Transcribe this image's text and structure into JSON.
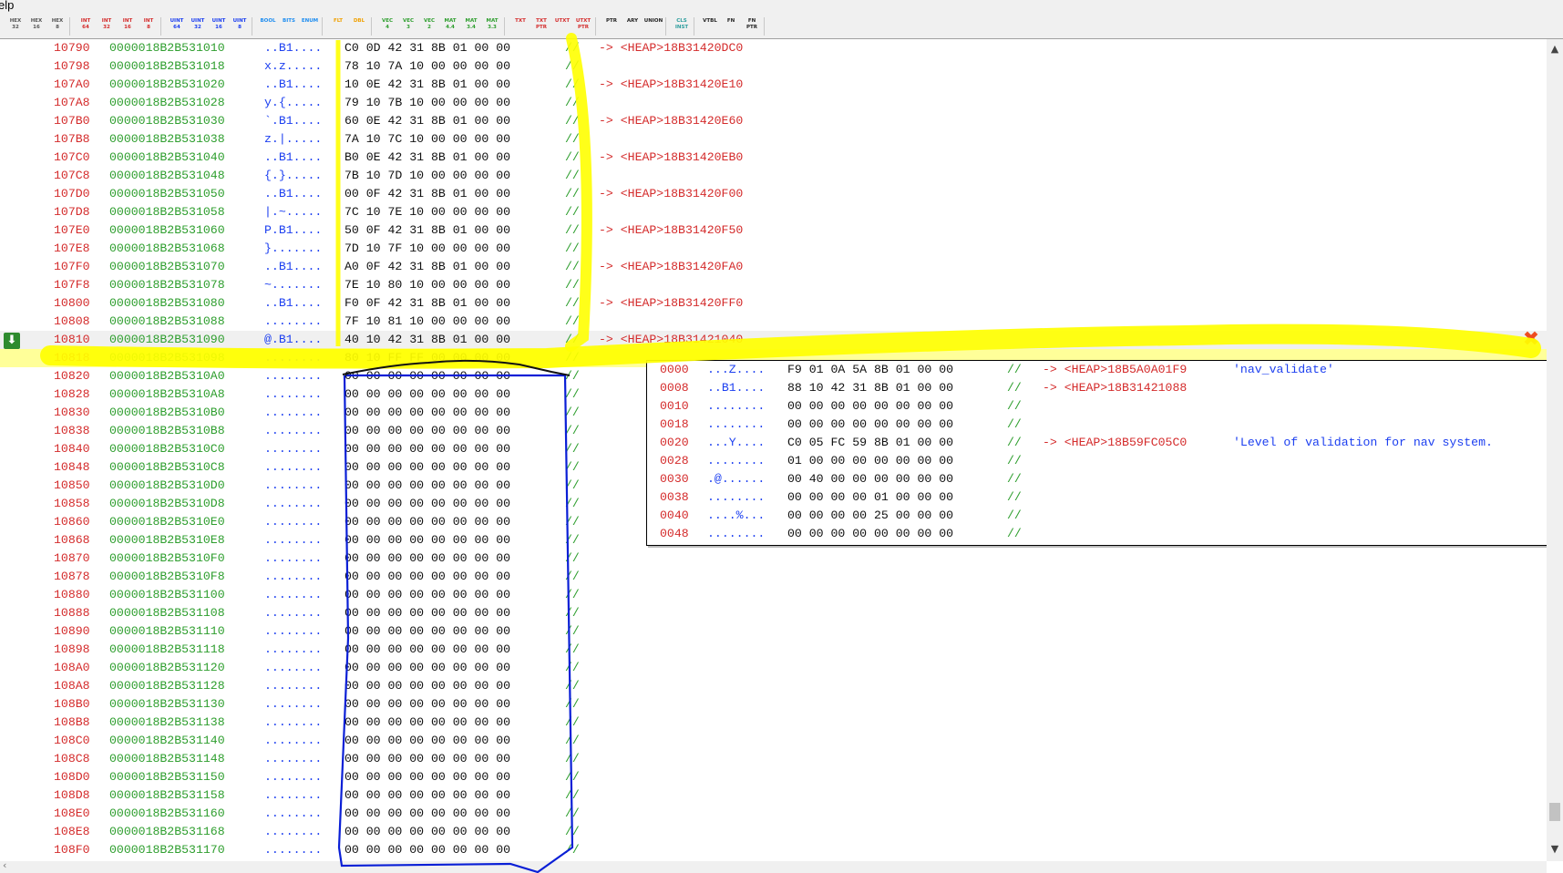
{
  "menu": {
    "help_label": "elp"
  },
  "toolbar": {
    "groups": [
      {
        "color": "#555555",
        "buttons": [
          {
            "top": "HEX",
            "bottom": "32"
          },
          {
            "top": "HEX",
            "bottom": "16"
          },
          {
            "top": "HEX",
            "bottom": "8"
          }
        ]
      },
      {
        "color": "#d42b2b",
        "buttons": [
          {
            "top": "INT",
            "bottom": "64"
          },
          {
            "top": "INT",
            "bottom": "32"
          },
          {
            "top": "INT",
            "bottom": "16"
          },
          {
            "top": "INT",
            "bottom": "8"
          }
        ]
      },
      {
        "color": "#1c3ff0",
        "buttons": [
          {
            "top": "UINT",
            "bottom": "64"
          },
          {
            "top": "UINT",
            "bottom": "32"
          },
          {
            "top": "UINT",
            "bottom": "16"
          },
          {
            "top": "UINT",
            "bottom": "8"
          }
        ]
      },
      {
        "color": "#1c8cf0",
        "buttons": [
          {
            "top": "BOOL",
            "bottom": ""
          },
          {
            "top": "BITS",
            "bottom": ""
          },
          {
            "top": "ENUM",
            "bottom": ""
          }
        ]
      },
      {
        "color": "#f0a000",
        "buttons": [
          {
            "top": "FLT",
            "bottom": ""
          },
          {
            "top": "DBL",
            "bottom": ""
          }
        ]
      },
      {
        "color": "#2e9e2e",
        "buttons": [
          {
            "top": "VEC",
            "bottom": "4"
          },
          {
            "top": "VEC",
            "bottom": "3"
          },
          {
            "top": "VEC",
            "bottom": "2"
          },
          {
            "top": "MAT",
            "bottom": "4.4"
          },
          {
            "top": "MAT",
            "bottom": "3.4"
          },
          {
            "top": "MAT",
            "bottom": "3.3"
          }
        ]
      },
      {
        "color": "#d42b2b",
        "buttons": [
          {
            "top": "TXT",
            "bottom": ""
          },
          {
            "top": "TXT",
            "bottom": "PTR"
          },
          {
            "top": "UTXT",
            "bottom": ""
          },
          {
            "top": "UTXT",
            "bottom": "PTR"
          }
        ]
      },
      {
        "color": "#222222",
        "buttons": [
          {
            "top": "PTR",
            "bottom": ""
          },
          {
            "top": "ARY",
            "bottom": ""
          },
          {
            "top": "UNION",
            "bottom": ""
          }
        ]
      },
      {
        "color": "#2e9e9e",
        "buttons": [
          {
            "top": "CLS",
            "bottom": "INST"
          }
        ]
      },
      {
        "color": "#222222",
        "buttons": [
          {
            "top": "VTBL",
            "bottom": ""
          },
          {
            "top": "FN",
            "bottom": ""
          },
          {
            "top": "FN",
            "bottom": "PTR"
          }
        ]
      }
    ]
  },
  "rows": [
    {
      "off": "10790",
      "addr": "0000018B2B531010",
      "ascii": "..B1....",
      "hex": "C0 0D 42 31 8B 01 00 00",
      "cmt": "//",
      "ptr": "-> <HEAP>18B31420DC0"
    },
    {
      "off": "10798",
      "addr": "0000018B2B531018",
      "ascii": "x.z.....",
      "hex": "78 10 7A 10 00 00 00 00",
      "cmt": "//",
      "ptr": ""
    },
    {
      "off": "107A0",
      "addr": "0000018B2B531020",
      "ascii": "..B1....",
      "hex": "10 0E 42 31 8B 01 00 00",
      "cmt": "//",
      "ptr": "-> <HEAP>18B31420E10"
    },
    {
      "off": "107A8",
      "addr": "0000018B2B531028",
      "ascii": "y.{.....",
      "hex": "79 10 7B 10 00 00 00 00",
      "cmt": "//",
      "ptr": ""
    },
    {
      "off": "107B0",
      "addr": "0000018B2B531030",
      "ascii": "`.B1....",
      "hex": "60 0E 42 31 8B 01 00 00",
      "cmt": "//",
      "ptr": "-> <HEAP>18B31420E60"
    },
    {
      "off": "107B8",
      "addr": "0000018B2B531038",
      "ascii": "z.|.....",
      "hex": "7A 10 7C 10 00 00 00 00",
      "cmt": "//",
      "ptr": ""
    },
    {
      "off": "107C0",
      "addr": "0000018B2B531040",
      "ascii": "..B1....",
      "hex": "B0 0E 42 31 8B 01 00 00",
      "cmt": "//",
      "ptr": "-> <HEAP>18B31420EB0"
    },
    {
      "off": "107C8",
      "addr": "0000018B2B531048",
      "ascii": "{.}.....",
      "hex": "7B 10 7D 10 00 00 00 00",
      "cmt": "//",
      "ptr": ""
    },
    {
      "off": "107D0",
      "addr": "0000018B2B531050",
      "ascii": "..B1....",
      "hex": "00 0F 42 31 8B 01 00 00",
      "cmt": "//",
      "ptr": "-> <HEAP>18B31420F00"
    },
    {
      "off": "107D8",
      "addr": "0000018B2B531058",
      "ascii": "|.~.....",
      "hex": "7C 10 7E 10 00 00 00 00",
      "cmt": "//",
      "ptr": ""
    },
    {
      "off": "107E0",
      "addr": "0000018B2B531060",
      "ascii": "P.B1....",
      "hex": "50 0F 42 31 8B 01 00 00",
      "cmt": "//",
      "ptr": "-> <HEAP>18B31420F50"
    },
    {
      "off": "107E8",
      "addr": "0000018B2B531068",
      "ascii": "}.......",
      "hex": "7D 10 7F 10 00 00 00 00",
      "cmt": "//",
      "ptr": ""
    },
    {
      "off": "107F0",
      "addr": "0000018B2B531070",
      "ascii": "..B1....",
      "hex": "A0 0F 42 31 8B 01 00 00",
      "cmt": "//",
      "ptr": "-> <HEAP>18B31420FA0"
    },
    {
      "off": "107F8",
      "addr": "0000018B2B531078",
      "ascii": "~.......",
      "hex": "7E 10 80 10 00 00 00 00",
      "cmt": "//",
      "ptr": ""
    },
    {
      "off": "10800",
      "addr": "0000018B2B531080",
      "ascii": "..B1....",
      "hex": "F0 0F 42 31 8B 01 00 00",
      "cmt": "//",
      "ptr": "-> <HEAP>18B31420FF0"
    },
    {
      "off": "10808",
      "addr": "0000018B2B531088",
      "ascii": "........",
      "hex": "7F 10 81 10 00 00 00 00",
      "cmt": "//",
      "ptr": ""
    },
    {
      "off": "10810",
      "addr": "0000018B2B531090",
      "ascii": "@.B1....",
      "hex": "40 10 42 31 8B 01 00 00",
      "cmt": "//",
      "ptr": "-> <HEAP>18B31421040",
      "state": "cur"
    },
    {
      "off": "10818",
      "addr": "0000018B2B531098",
      "ascii": "........",
      "hex": "80 10 FF FF 00 00 00 00",
      "cmt": "//",
      "ptr": "",
      "state": "hl"
    },
    {
      "off": "10820",
      "addr": "0000018B2B5310A0",
      "ascii": "........",
      "hex": "00 00 00 00 00 00 00 00",
      "cmt": "//",
      "ptr": ""
    },
    {
      "off": "10828",
      "addr": "0000018B2B5310A8",
      "ascii": "........",
      "hex": "00 00 00 00 00 00 00 00",
      "cmt": "//",
      "ptr": ""
    },
    {
      "off": "10830",
      "addr": "0000018B2B5310B0",
      "ascii": "........",
      "hex": "00 00 00 00 00 00 00 00",
      "cmt": "//",
      "ptr": ""
    },
    {
      "off": "10838",
      "addr": "0000018B2B5310B8",
      "ascii": "........",
      "hex": "00 00 00 00 00 00 00 00",
      "cmt": "//",
      "ptr": ""
    },
    {
      "off": "10840",
      "addr": "0000018B2B5310C0",
      "ascii": "........",
      "hex": "00 00 00 00 00 00 00 00",
      "cmt": "//",
      "ptr": ""
    },
    {
      "off": "10848",
      "addr": "0000018B2B5310C8",
      "ascii": "........",
      "hex": "00 00 00 00 00 00 00 00",
      "cmt": "//",
      "ptr": ""
    },
    {
      "off": "10850",
      "addr": "0000018B2B5310D0",
      "ascii": "........",
      "hex": "00 00 00 00 00 00 00 00",
      "cmt": "//",
      "ptr": ""
    },
    {
      "off": "10858",
      "addr": "0000018B2B5310D8",
      "ascii": "........",
      "hex": "00 00 00 00 00 00 00 00",
      "cmt": "//",
      "ptr": ""
    },
    {
      "off": "10860",
      "addr": "0000018B2B5310E0",
      "ascii": "........",
      "hex": "00 00 00 00 00 00 00 00",
      "cmt": "//",
      "ptr": ""
    },
    {
      "off": "10868",
      "addr": "0000018B2B5310E8",
      "ascii": "........",
      "hex": "00 00 00 00 00 00 00 00",
      "cmt": "//",
      "ptr": ""
    },
    {
      "off": "10870",
      "addr": "0000018B2B5310F0",
      "ascii": "........",
      "hex": "00 00 00 00 00 00 00 00",
      "cmt": "//",
      "ptr": ""
    },
    {
      "off": "10878",
      "addr": "0000018B2B5310F8",
      "ascii": "........",
      "hex": "00 00 00 00 00 00 00 00",
      "cmt": "//",
      "ptr": ""
    },
    {
      "off": "10880",
      "addr": "0000018B2B531100",
      "ascii": "........",
      "hex": "00 00 00 00 00 00 00 00",
      "cmt": "//",
      "ptr": ""
    },
    {
      "off": "10888",
      "addr": "0000018B2B531108",
      "ascii": "........",
      "hex": "00 00 00 00 00 00 00 00",
      "cmt": "//",
      "ptr": ""
    },
    {
      "off": "10890",
      "addr": "0000018B2B531110",
      "ascii": "........",
      "hex": "00 00 00 00 00 00 00 00",
      "cmt": "//",
      "ptr": ""
    },
    {
      "off": "10898",
      "addr": "0000018B2B531118",
      "ascii": "........",
      "hex": "00 00 00 00 00 00 00 00",
      "cmt": "//",
      "ptr": ""
    },
    {
      "off": "108A0",
      "addr": "0000018B2B531120",
      "ascii": "........",
      "hex": "00 00 00 00 00 00 00 00",
      "cmt": "//",
      "ptr": ""
    },
    {
      "off": "108A8",
      "addr": "0000018B2B531128",
      "ascii": "........",
      "hex": "00 00 00 00 00 00 00 00",
      "cmt": "//",
      "ptr": ""
    },
    {
      "off": "108B0",
      "addr": "0000018B2B531130",
      "ascii": "........",
      "hex": "00 00 00 00 00 00 00 00",
      "cmt": "//",
      "ptr": ""
    },
    {
      "off": "108B8",
      "addr": "0000018B2B531138",
      "ascii": "........",
      "hex": "00 00 00 00 00 00 00 00",
      "cmt": "//",
      "ptr": ""
    },
    {
      "off": "108C0",
      "addr": "0000018B2B531140",
      "ascii": "........",
      "hex": "00 00 00 00 00 00 00 00",
      "cmt": "//",
      "ptr": ""
    },
    {
      "off": "108C8",
      "addr": "0000018B2B531148",
      "ascii": "........",
      "hex": "00 00 00 00 00 00 00 00",
      "cmt": "//",
      "ptr": ""
    },
    {
      "off": "108D0",
      "addr": "0000018B2B531150",
      "ascii": "........",
      "hex": "00 00 00 00 00 00 00 00",
      "cmt": "//",
      "ptr": ""
    },
    {
      "off": "108D8",
      "addr": "0000018B2B531158",
      "ascii": "........",
      "hex": "00 00 00 00 00 00 00 00",
      "cmt": "//",
      "ptr": ""
    },
    {
      "off": "108E0",
      "addr": "0000018B2B531160",
      "ascii": "........",
      "hex": "00 00 00 00 00 00 00 00",
      "cmt": "//",
      "ptr": ""
    },
    {
      "off": "108E8",
      "addr": "0000018B2B531168",
      "ascii": "........",
      "hex": "00 00 00 00 00 00 00 00",
      "cmt": "//",
      "ptr": ""
    },
    {
      "off": "108F0",
      "addr": "0000018B2B531170",
      "ascii": "........",
      "hex": "00 00 00 00 00 00 00 00",
      "cmt": "//",
      "ptr": ""
    }
  ],
  "popup": {
    "rows": [
      {
        "off": "0000",
        "ascii": "...Z....",
        "hex": "F9 01 0A 5A 8B 01 00 00",
        "cmt": "//",
        "ptr": "-> <HEAP>18B5A0A01F9",
        "str": "'nav_validate'"
      },
      {
        "off": "0008",
        "ascii": "..B1....",
        "hex": "88 10 42 31 8B 01 00 00",
        "cmt": "//",
        "ptr": "-> <HEAP>18B31421088",
        "str": ""
      },
      {
        "off": "0010",
        "ascii": "........",
        "hex": "00 00 00 00 00 00 00 00",
        "cmt": "//",
        "ptr": "",
        "str": ""
      },
      {
        "off": "0018",
        "ascii": "........",
        "hex": "00 00 00 00 00 00 00 00",
        "cmt": "//",
        "ptr": "",
        "str": ""
      },
      {
        "off": "0020",
        "ascii": "...Y....",
        "hex": "C0 05 FC 59 8B 01 00 00",
        "cmt": "//",
        "ptr": "-> <HEAP>18B59FC05C0",
        "str": "'Level of validation for nav system."
      },
      {
        "off": "0028",
        "ascii": "........",
        "hex": "01 00 00 00 00 00 00 00",
        "cmt": "//",
        "ptr": "",
        "str": ""
      },
      {
        "off": "0030",
        "ascii": ".@......",
        "hex": "00 40 00 00 00 00 00 00",
        "cmt": "//",
        "ptr": "",
        "str": ""
      },
      {
        "off": "0038",
        "ascii": "........",
        "hex": "00 00 00 00 01 00 00 00",
        "cmt": "//",
        "ptr": "",
        "str": ""
      },
      {
        "off": "0040",
        "ascii": "....%...",
        "hex": "00 00 00 00 25 00 00 00",
        "cmt": "//",
        "ptr": "",
        "str": ""
      },
      {
        "off": "0048",
        "ascii": "........",
        "hex": "00 00 00 00 00 00 00 00",
        "cmt": "//",
        "ptr": "",
        "str": ""
      }
    ],
    "close_icon": "close-x-icon"
  },
  "icons": {
    "row_marker": "down-arrow-icon"
  },
  "colors": {
    "offset": "#d42b2b",
    "address": "#2e9e2e",
    "ascii": "#1c3ff0",
    "highlight_row": "#ffff99",
    "annotation_yellow": "#ffff00",
    "annotation_blue": "#0a1fd6"
  }
}
